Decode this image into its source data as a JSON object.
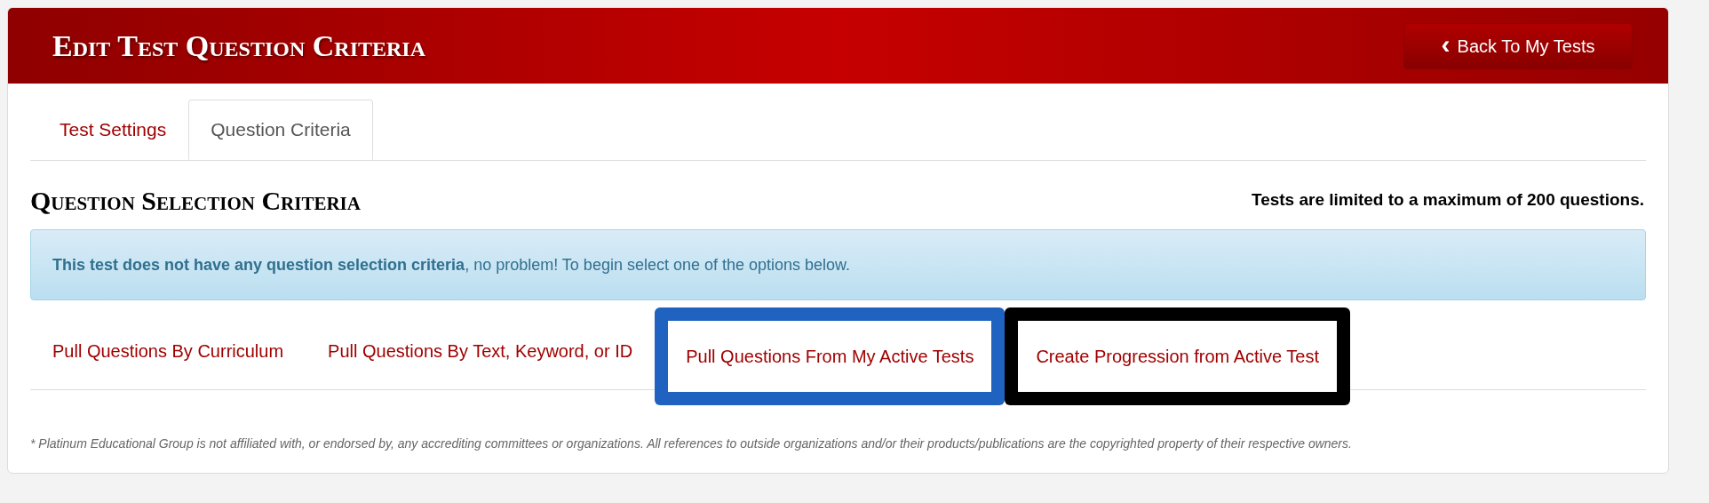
{
  "header": {
    "title": "Edit Test Question Criteria",
    "back_button": {
      "icon": "‹",
      "label": "Back To My Tests"
    }
  },
  "tabs": [
    {
      "label": "Test Settings",
      "selected": false
    },
    {
      "label": "Question Criteria",
      "selected": true
    }
  ],
  "section": {
    "title": "Question Selection Criteria",
    "limit_note": "Tests are limited to a maximum of 200 questions."
  },
  "alert": {
    "text": "**This test does not have any question selection criteria**, no problem! To begin select one of the options below."
  },
  "options": [
    {
      "label": "Pull Questions By Curriculum"
    },
    {
      "label": "Pull Questions By Text, Keyword, or ID"
    },
    {
      "label": "Pull Questions From My Active Tests",
      "color": "#1f62bf"
    },
    {
      "label": "Create Progression from Active Test",
      "color": "#000000"
    }
  ],
  "footnote": "* Platinum Educational Group is not affiliated with, or endorsed by, any accrediting committees or organizations. All references to outside organizations and/or their products/publications are the copyrighted property of their respective owners."
}
